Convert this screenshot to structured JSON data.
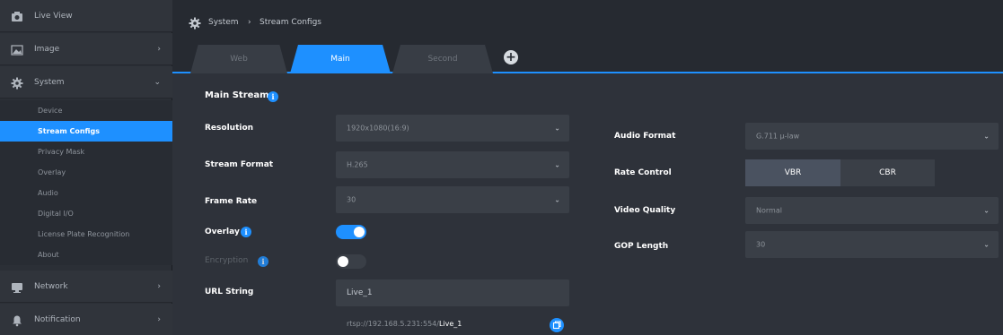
{
  "sidebar": {
    "items": [
      {
        "label": "Live View",
        "icon": "video-camera-icon"
      },
      {
        "label": "Image",
        "icon": "image-icon",
        "chevron": "›"
      },
      {
        "label": "System",
        "icon": "gear-icon",
        "chevron": "⌄"
      },
      {
        "label": "Network",
        "icon": "monitor-icon",
        "chevron": "›"
      },
      {
        "label": "Notification",
        "icon": "bell-icon",
        "chevron": "›"
      }
    ],
    "system_sub": [
      {
        "label": "Device"
      },
      {
        "label": "Stream Configs"
      },
      {
        "label": "Privacy Mask"
      },
      {
        "label": "Overlay"
      },
      {
        "label": "Audio"
      },
      {
        "label": "Digital I/O"
      },
      {
        "label": "License Plate Recognition"
      },
      {
        "label": "About"
      }
    ],
    "active_sub": "Stream Configs"
  },
  "breadcrumb": {
    "root": "System",
    "separator": "›",
    "current": "Stream Configs"
  },
  "tabs": [
    {
      "label": "Web",
      "active": false
    },
    {
      "label": "Main",
      "active": true
    },
    {
      "label": "Second",
      "active": false
    }
  ],
  "add_tab": "+",
  "section": {
    "title": "Main Stream",
    "info": "i"
  },
  "left_fields": {
    "resolution": {
      "label": "Resolution",
      "value": "1920x1080(16:9)"
    },
    "stream_format": {
      "label": "Stream Format",
      "value": "H.265"
    },
    "frame_rate": {
      "label": "Frame Rate",
      "value": "30"
    },
    "overlay": {
      "label": "Overlay",
      "on": true
    },
    "encryption": {
      "label": "Encryption",
      "on": false
    },
    "url_string": {
      "label": "URL String",
      "value": "Live_1"
    },
    "rtsp": {
      "prefix": "rtsp://192.168.5.231:554/",
      "stream": "Live_1"
    }
  },
  "right_fields": {
    "audio_format": {
      "label": "Audio Format",
      "value": "G.711 μ-law"
    },
    "rate_control": {
      "label": "Rate Control",
      "options": [
        "VBR",
        "CBR"
      ],
      "selected": "VBR"
    },
    "video_quality": {
      "label": "Video Quality",
      "value": "Normal"
    },
    "gop_length": {
      "label": "GOP Length",
      "value": "30"
    }
  },
  "caret": "⌄",
  "colors": {
    "accent": "#1e90ff",
    "sidebar_bg": "#2b2f36",
    "content_bg": "#2e323a"
  }
}
